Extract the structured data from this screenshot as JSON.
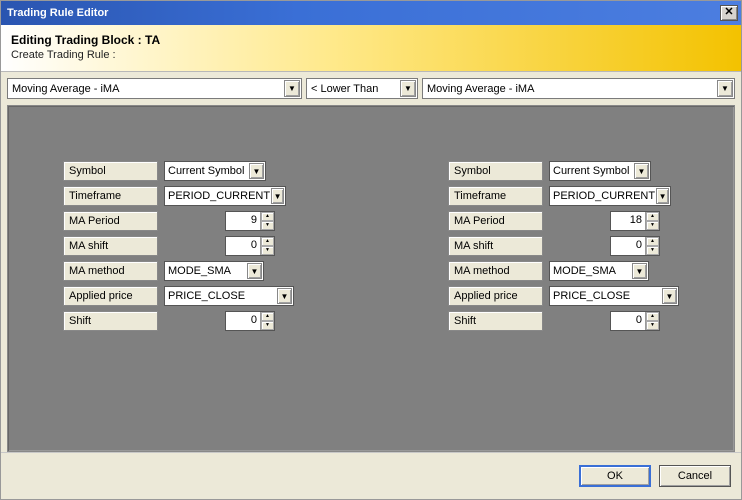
{
  "window": {
    "title": "Trading Rule Editor"
  },
  "header": {
    "title": "Editing Trading Block : TA",
    "subtitle": "Create Trading Rule :"
  },
  "top": {
    "left_indicator": "Moving Average - iMA",
    "comparator": "< Lower Than",
    "right_indicator": "Moving Average - iMA"
  },
  "labels": {
    "symbol": "Symbol",
    "timeframe": "Timeframe",
    "ma_period": "MA Period",
    "ma_shift": "MA shift",
    "ma_method": "MA method",
    "applied_price": "Applied price",
    "shift": "Shift"
  },
  "left": {
    "symbol": "Current Symbol",
    "timeframe": "PERIOD_CURRENT",
    "ma_period": "9",
    "ma_shift": "0",
    "ma_method": "MODE_SMA",
    "applied_price": "PRICE_CLOSE",
    "shift": "0"
  },
  "right": {
    "symbol": "Current Symbol",
    "timeframe": "PERIOD_CURRENT",
    "ma_period": "18",
    "ma_shift": "0",
    "ma_method": "MODE_SMA",
    "applied_price": "PRICE_CLOSE",
    "shift": "0"
  },
  "footer": {
    "ok": "OK",
    "cancel": "Cancel"
  }
}
